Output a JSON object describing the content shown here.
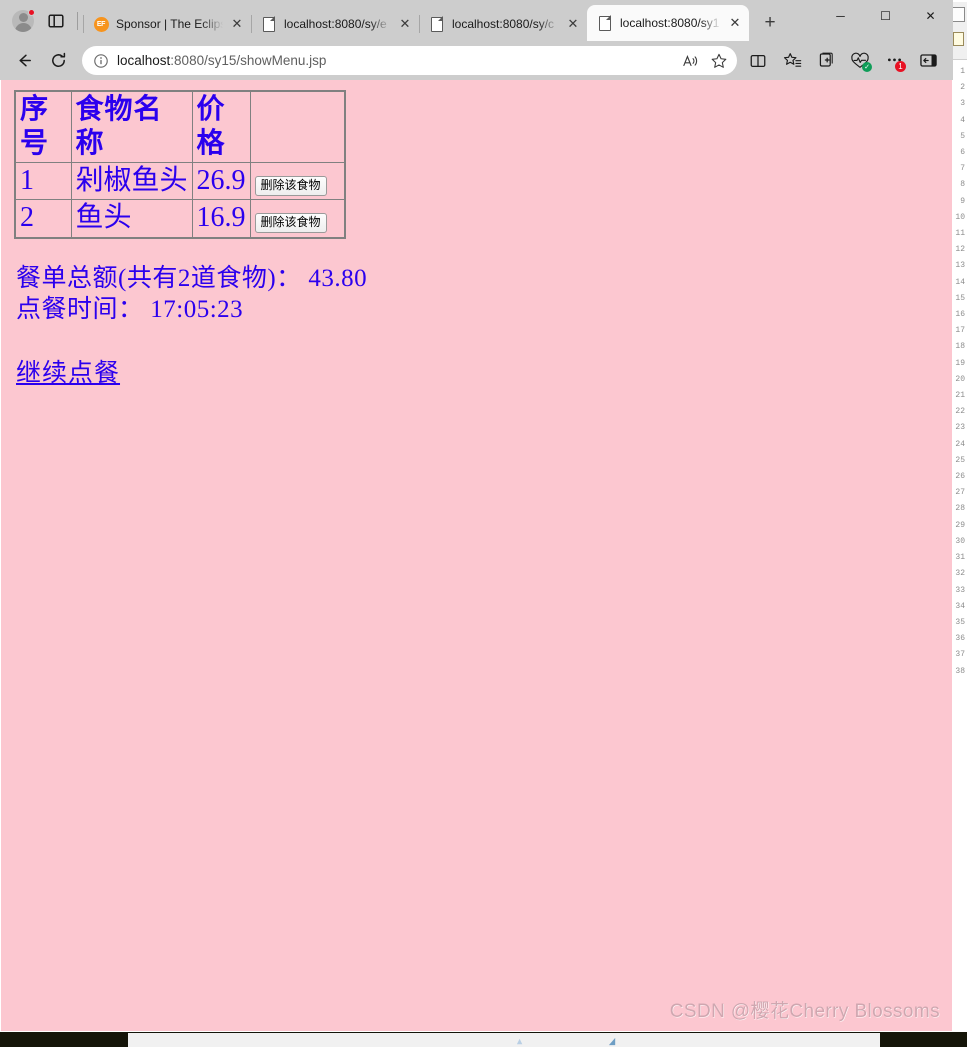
{
  "browser": {
    "name": "Microsoft Edge",
    "profile_icon": "account-avatar-icon",
    "tab_actions_icon": "tab-actions-icon",
    "new_tab_label": "+",
    "window_controls": {
      "minimize": "─",
      "maximize": "☐",
      "close": "✕"
    },
    "tabs": [
      {
        "title": "Sponsor | The Eclips",
        "favicon": "eclipse-foundation-icon",
        "active": false,
        "close_label": "✕"
      },
      {
        "title": "localhost:8080/sy/e",
        "favicon": "blank-document-icon",
        "active": false,
        "close_label": "✕"
      },
      {
        "title": "localhost:8080/sy/c",
        "favicon": "blank-document-icon",
        "active": false,
        "close_label": "✕"
      },
      {
        "title": "localhost:8080/sy1",
        "favicon": "blank-document-icon",
        "active": true,
        "close_label": "✕"
      }
    ],
    "toolbar": {
      "back_label": "←",
      "refresh_label": "↻",
      "site_info_label": "ⓘ",
      "url_host": "localhost",
      "url_path": ":8080/sy15/showMenu.jsp",
      "url_full": "localhost:8080/sy15/showMenu.jsp",
      "read_aloud_icon": "read-aloud-icon",
      "favorite_icon": "favorite-star-icon",
      "split_screen_icon": "split-screen-icon",
      "favorites_list_icon": "favorites-list-icon",
      "collections_icon": "collections-add-icon",
      "browser_essentials_icon": "browser-essentials-icon",
      "settings_more_icon": "settings-and-more-icon",
      "settings_badge": "1",
      "sidebar_toggle_icon": "sidebar-toggle-icon"
    }
  },
  "page": {
    "background_color": "#fcc7d0",
    "text_color": "#2b00ee",
    "table": {
      "headers": [
        "序号",
        "食物名称",
        "价格",
        ""
      ],
      "rows": [
        {
          "index": "1",
          "name": "剁椒鱼头",
          "price": "26.9",
          "action_label": "删除该食物"
        },
        {
          "index": "2",
          "name": "鱼头",
          "price": "16.9",
          "action_label": "删除该食物"
        }
      ]
    },
    "summary_total": "餐单总额(共有2道食物)： 43.80",
    "summary_time": "点餐时间： 17:05:23",
    "continue_link": "继续点餐",
    "watermark": "CSDN @樱花Cherry Blossoms"
  },
  "background_window": {
    "line_numbers": "1\n2\n3\n4\n5\n6\n7\n8\n9\n10\n11\n12\n13\n14\n15\n16\n17\n18\n19\n20\n21\n22\n23\n24\n25\n26\n27\n28\n29\n30\n31\n32\n33\n34\n35\n36\n37\n38"
  }
}
